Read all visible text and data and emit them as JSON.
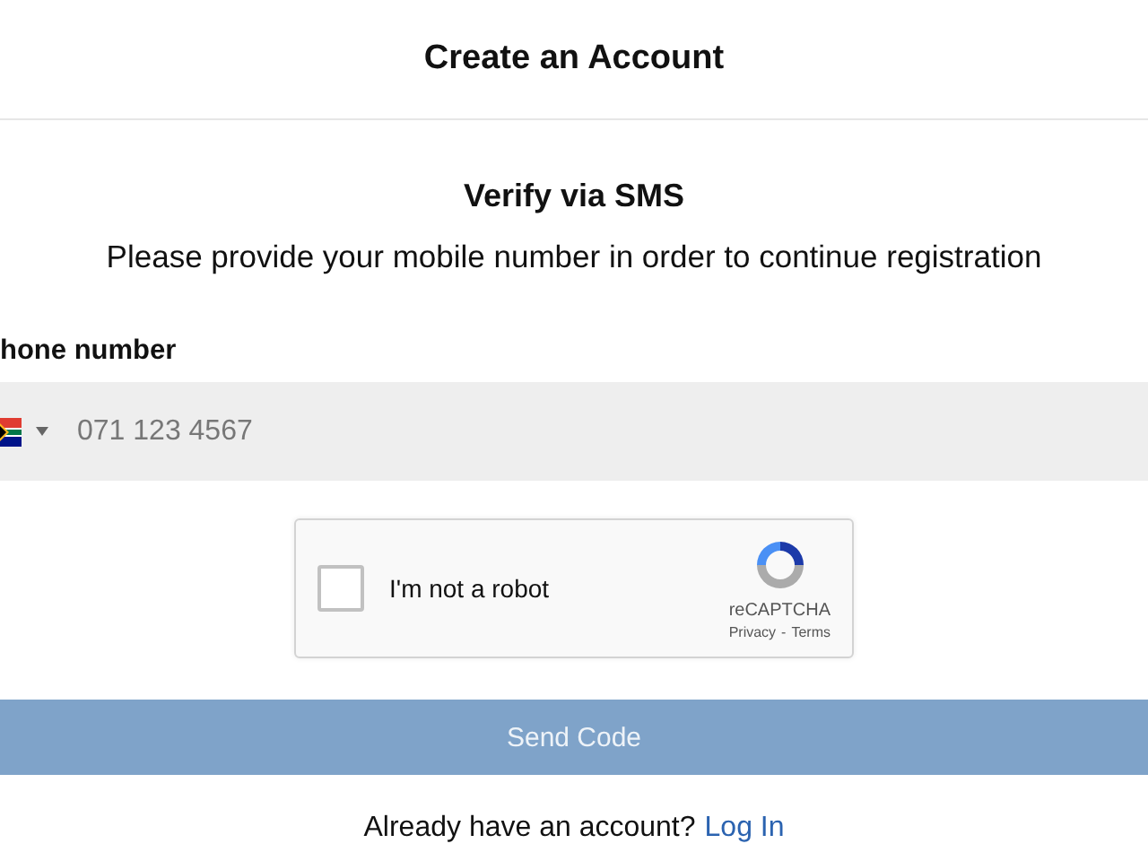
{
  "header": {
    "title": "Create an Account"
  },
  "heading": "Verify via SMS",
  "subtitle": "Please provide your mobile number in order to continue registration",
  "phone": {
    "label": "hone number",
    "placeholder": "071 123 4567"
  },
  "captcha": {
    "label": "I'm not a robot",
    "checked": false,
    "brand": "reCAPTCHA",
    "privacy": "Privacy",
    "separator": "-",
    "terms": "Terms"
  },
  "submit": {
    "label": "Send Code",
    "disabled": true
  },
  "footer": {
    "text": "Already have an account?",
    "link": "Log In"
  }
}
